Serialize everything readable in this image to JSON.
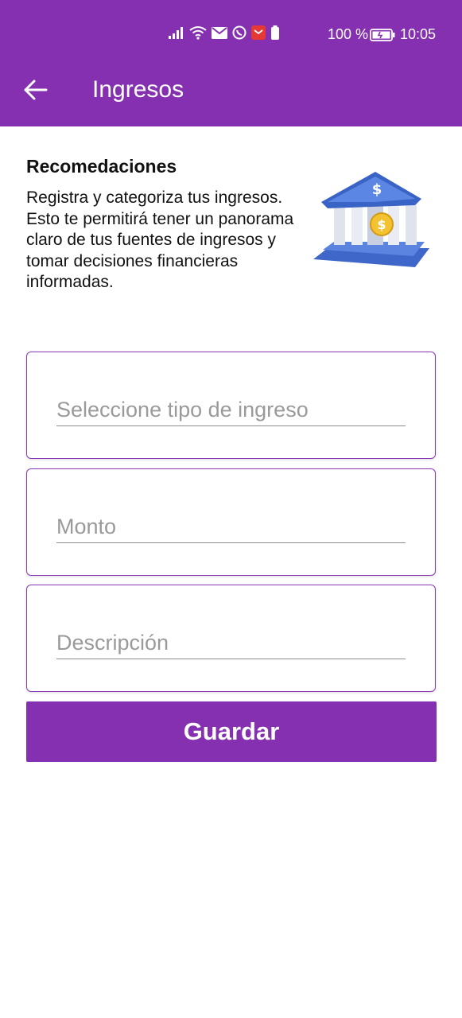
{
  "status_bar": {
    "battery_percent": "100 %",
    "time": "10:05",
    "icons": [
      "signal-icon",
      "wifi-icon",
      "mail-icon",
      "whatsapp-icon",
      "notification-icon",
      "battery-saver-icon",
      "battery-icon"
    ]
  },
  "app_bar": {
    "title": "Ingresos",
    "back_icon": "arrow-left-icon",
    "background": "#8530b0"
  },
  "recommendation": {
    "title": "Recomedaciones",
    "text": "Registra y categoriza tus ingresos. Esto te permitirá tener un panorama claro de tus fuentes de ingresos y tomar decisiones financieras informadas.",
    "illustration": "bank-icon"
  },
  "form": {
    "income_type_placeholder": "Seleccione tipo de ingreso",
    "amount_placeholder": "Monto",
    "description_placeholder": "Descripción",
    "save_label": "Guardar"
  },
  "colors": {
    "accent": "#8530b0",
    "field_border": "#8a3ab6",
    "underline": "#8d8d8d"
  }
}
